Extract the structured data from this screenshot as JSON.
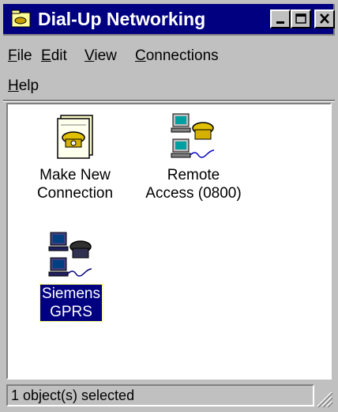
{
  "window": {
    "title": "Dial-Up Networking",
    "title_icon": "dialup-folder-icon",
    "controls": {
      "minimize": "minimize-icon",
      "maximize": "maximize-icon",
      "close": "close-icon"
    }
  },
  "menubar": {
    "file": {
      "label": "File",
      "accel": "F",
      "rest": "ile"
    },
    "edit": {
      "label": "Edit",
      "accel": "E",
      "rest": "dit"
    },
    "view": {
      "label": "View",
      "accel": "V",
      "rest": "iew"
    },
    "connections": {
      "label": "Connections",
      "accel": "C",
      "rest": "onnections"
    },
    "help": {
      "label": "Help",
      "accel": "H",
      "rest": "elp"
    }
  },
  "items": [
    {
      "label_line1": "Make New",
      "label_line2": "Connection",
      "icon": "make-new-connection-icon",
      "selected": false
    },
    {
      "label_line1": "Remote",
      "label_line2": "Access (0800)",
      "icon": "dialup-connection-icon",
      "selected": false
    },
    {
      "label_line1": "Siemens",
      "label_line2": "GPRS",
      "icon": "dialup-connection-icon",
      "selected": true
    }
  ],
  "status": {
    "text": "1 object(s) selected"
  },
  "colors": {
    "title_bg": "#000080",
    "face": "#c0c0c0",
    "selection": "#000080"
  }
}
